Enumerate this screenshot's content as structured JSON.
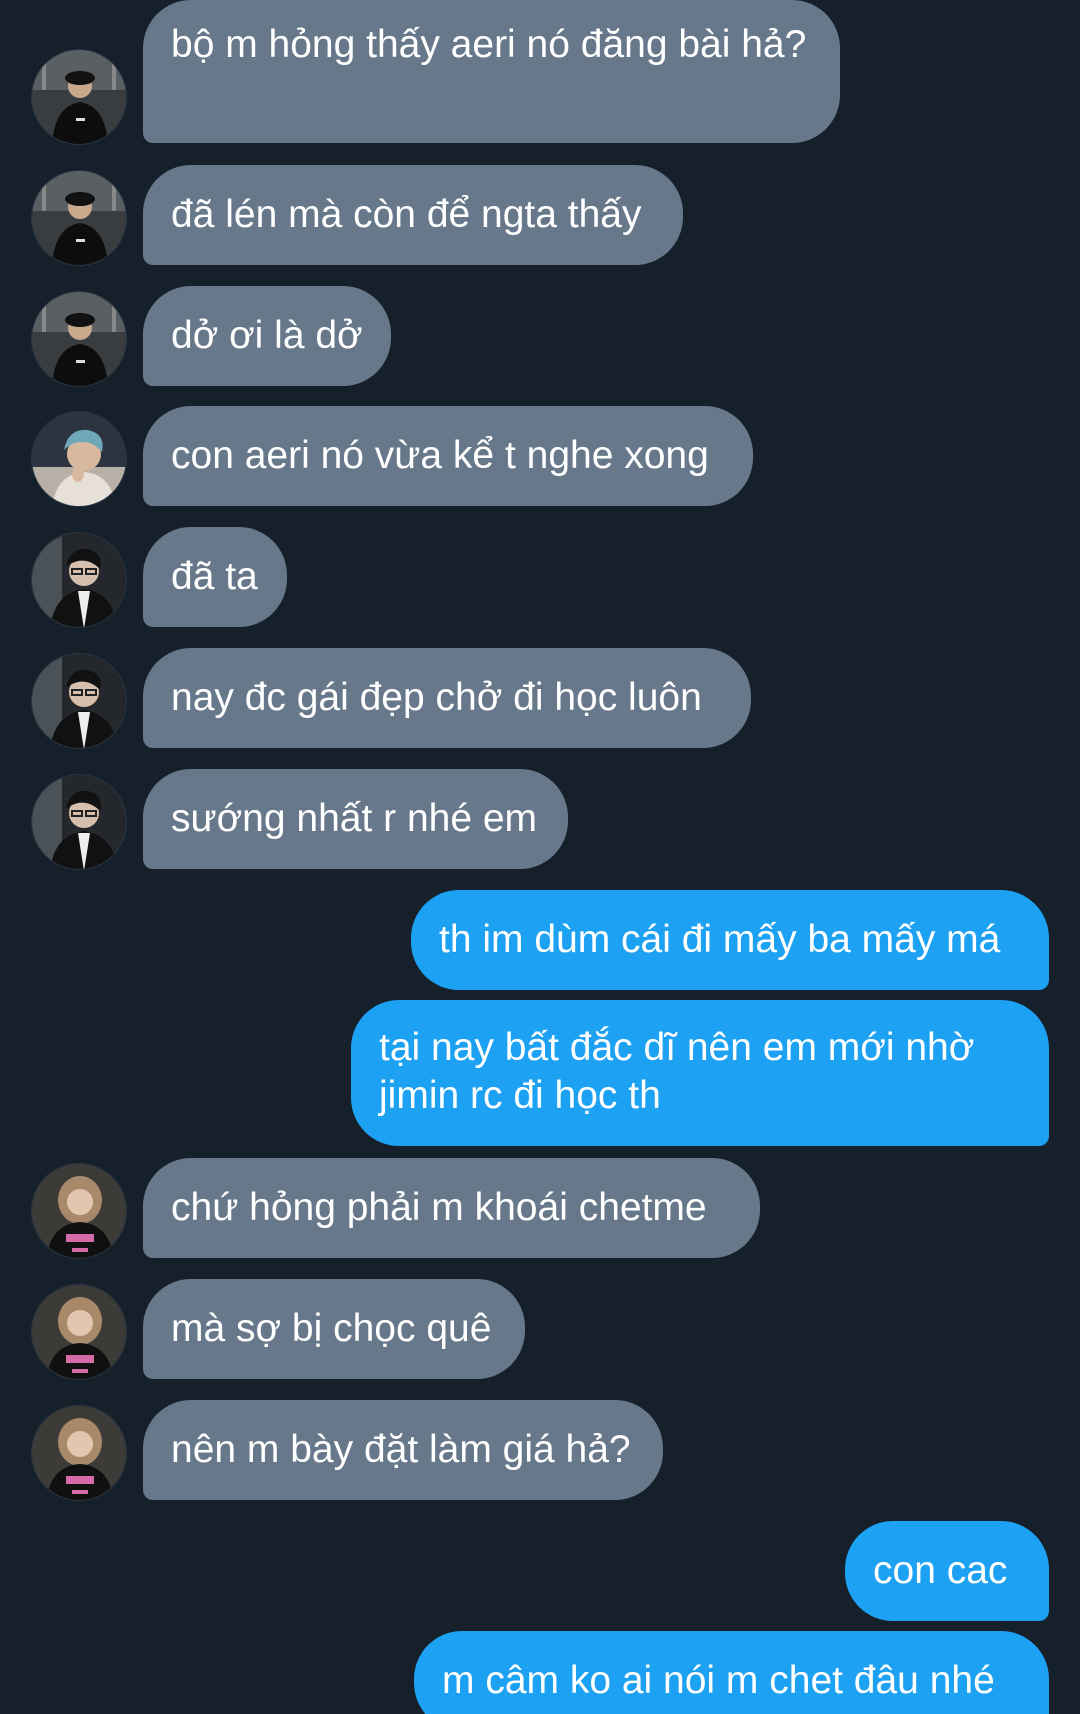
{
  "conversation": {
    "messages": [
      {
        "side": "in",
        "avatar": "avatar-cap-guy",
        "text": "bộ m hỏng thấy aeri nó đăng bài hả?"
      },
      {
        "side": "in",
        "avatar": "avatar-cap-guy",
        "text": "đã lén mà còn để ngta thấy"
      },
      {
        "side": "in",
        "avatar": "avatar-cap-guy",
        "text": "dở ơi là dở"
      },
      {
        "side": "in",
        "avatar": "avatar-blue-hair-guy",
        "text": "con aeri nó vừa kể t nghe xong"
      },
      {
        "side": "in",
        "avatar": "avatar-glasses-guy",
        "text": "đã ta"
      },
      {
        "side": "in",
        "avatar": "avatar-glasses-guy",
        "text": "nay đc gái đẹp chở đi học luôn"
      },
      {
        "side": "in",
        "avatar": "avatar-glasses-guy",
        "text": "sướng nhất r nhé em"
      },
      {
        "side": "out",
        "avatar": "",
        "text": "th im dùm cái đi mấy ba mấy má"
      },
      {
        "side": "out",
        "avatar": "",
        "text": "tại nay bất đắc dĩ nên em mới nhờ jimin rc đi học th"
      },
      {
        "side": "in",
        "avatar": "avatar-girl",
        "text": "chứ hỏng phải m khoái chetme"
      },
      {
        "side": "in",
        "avatar": "avatar-girl",
        "text": "mà sợ bị chọc quê"
      },
      {
        "side": "in",
        "avatar": "avatar-girl",
        "text": "nên m bày đặt làm giá hả?"
      },
      {
        "side": "out",
        "avatar": "",
        "text": "con cac"
      },
      {
        "side": "out",
        "avatar": "",
        "text": "m câm ko ai nói m chet đâu nhé"
      }
    ]
  },
  "colors": {
    "background": "#15202b",
    "incoming_bubble": "#66788a",
    "outgoing_bubble": "#1da1f2",
    "text": "#ffffff"
  }
}
